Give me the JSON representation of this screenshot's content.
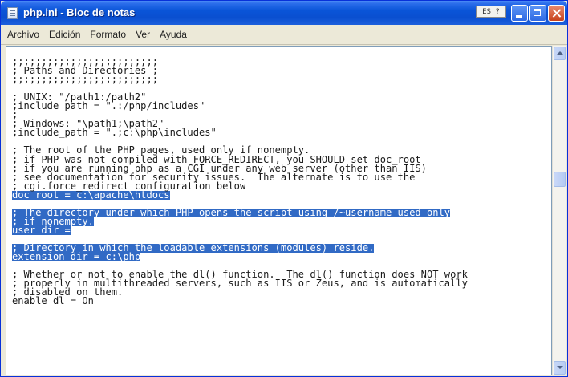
{
  "window": {
    "title": "php.ini - Bloc de notas",
    "ime_indicator": "ES ?"
  },
  "menu": [
    "Archivo",
    "Edición",
    "Formato",
    "Ver",
    "Ayuda"
  ],
  "editor": {
    "lines": [
      ";;;;;;;;;;;;;;;;;;;;;;;;;",
      "; Paths and Directories ;",
      ";;;;;;;;;;;;;;;;;;;;;;;;;",
      "",
      "; UNIX: \"/path1:/path2\"",
      ";include_path = \".:/php/includes\"",
      ";",
      "; Windows: \"\\path1;\\path2\"",
      ";include_path = \".;c:\\php\\includes\"",
      "",
      "; The root of the PHP pages, used only if nonempty.",
      "; if PHP was not compiled with FORCE_REDIRECT, you SHOULD set doc_root",
      "; if you are running php as a CGI under any web server (other than IIS)",
      "; see documentation for security issues.  The alternate is to use the",
      "; cgi.force_redirect configuration below",
      "doc_root = c:\\apache\\htdocs",
      "",
      "; The directory under which PHP opens the script using /~username used only",
      "; if nonempty.",
      "user_dir =",
      "",
      "; Directory in which the loadable extensions (modules) reside.",
      "extension_dir = c:\\php",
      "",
      "; Whether or not to enable the dl() function.  The dl() function does NOT work",
      "; properly in multithreaded servers, such as IIS or Zeus, and is automatically",
      "; disabled on them.",
      "enable_dl = On"
    ],
    "selected_lines": [
      15,
      17,
      18,
      19,
      21,
      22
    ]
  }
}
